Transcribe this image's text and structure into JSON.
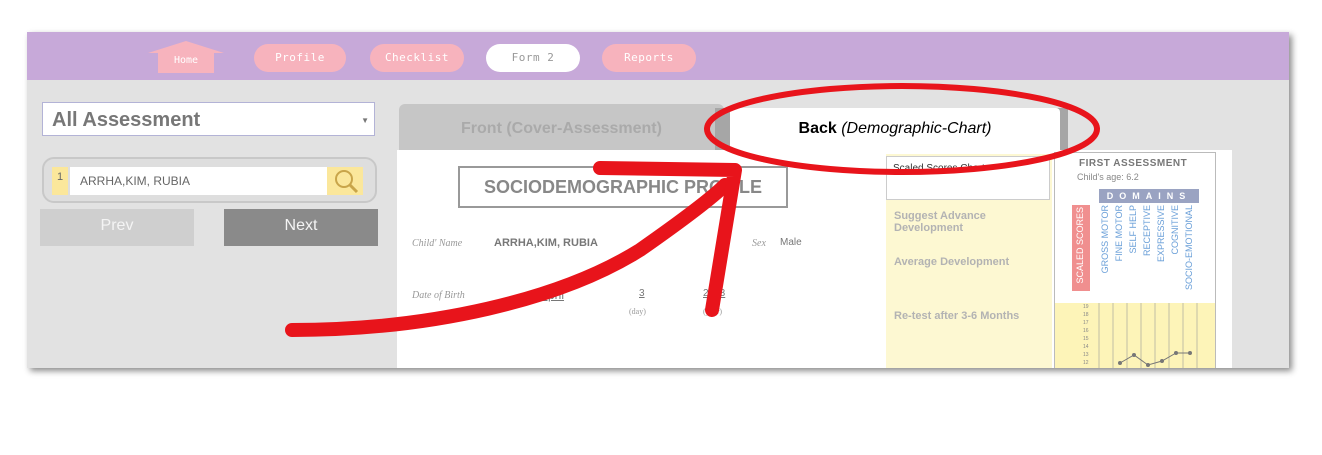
{
  "nav": {
    "home": "Home",
    "profile": "Profile",
    "checklist": "Checklist",
    "form2": "Form 2",
    "reports": "Reports"
  },
  "left": {
    "assessment_select": "All Assessment",
    "child_number": "1",
    "child_name": "ARRHA,KIM, RUBIA",
    "prev": "Prev",
    "next": "Next"
  },
  "tabs": {
    "front": "Front (Cover-Assessment)",
    "back_bold": "Back",
    "back_italic": "(Demographic-Chart)"
  },
  "profile": {
    "title": "SOCIODEMOGRAPHIC PROFILE",
    "child_name_label": "Child' Name",
    "child_name_value": "ARRHA,KIM, RUBIA",
    "sex_label": "Sex",
    "sex_value": "Male",
    "dob_label": "Date of Birth",
    "dob_month": "April",
    "dob_day": "3",
    "dob_year": "2013",
    "day_caption": "(day)",
    "year_caption": "(year)"
  },
  "scale": {
    "header": "Scaled Scores Chart",
    "advance": "Suggest Advance Development",
    "average": "Average Development",
    "retest": "Re-test after 3-6 Months"
  },
  "chart": {
    "title": "FIRST ASSESSMENT",
    "age": "Child's age: 6.2",
    "domains": "DOMAINS",
    "scaled_scores": "SCALED SCORES",
    "domain_labels": [
      "GROSS MOTOR",
      "FINE MOTOR",
      "SELF HELP",
      "RECEPTIVE",
      "EXPRESSIVE",
      "COGNITIVE",
      "SOCIO-EMOTIONAL"
    ],
    "axis_ticks": [
      "19",
      "18",
      "17",
      "16",
      "15",
      "14",
      "13",
      "12",
      "11"
    ]
  },
  "colors": {
    "nav_bar": "#c7a9d9",
    "nav_button": "#f7b3bd",
    "annotation": "#e8141b"
  }
}
